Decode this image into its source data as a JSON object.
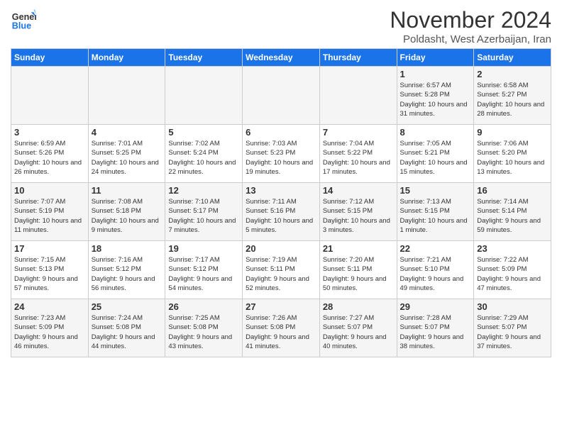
{
  "logo": {
    "line1": "General",
    "line2": "Blue"
  },
  "title": "November 2024",
  "subtitle": "Poldasht, West Azerbaijan, Iran",
  "headers": [
    "Sunday",
    "Monday",
    "Tuesday",
    "Wednesday",
    "Thursday",
    "Friday",
    "Saturday"
  ],
  "weeks": [
    [
      {
        "day": "",
        "info": ""
      },
      {
        "day": "",
        "info": ""
      },
      {
        "day": "",
        "info": ""
      },
      {
        "day": "",
        "info": ""
      },
      {
        "day": "",
        "info": ""
      },
      {
        "day": "1",
        "info": "Sunrise: 6:57 AM\nSunset: 5:28 PM\nDaylight: 10 hours and 31 minutes."
      },
      {
        "day": "2",
        "info": "Sunrise: 6:58 AM\nSunset: 5:27 PM\nDaylight: 10 hours and 28 minutes."
      }
    ],
    [
      {
        "day": "3",
        "info": "Sunrise: 6:59 AM\nSunset: 5:26 PM\nDaylight: 10 hours and 26 minutes."
      },
      {
        "day": "4",
        "info": "Sunrise: 7:01 AM\nSunset: 5:25 PM\nDaylight: 10 hours and 24 minutes."
      },
      {
        "day": "5",
        "info": "Sunrise: 7:02 AM\nSunset: 5:24 PM\nDaylight: 10 hours and 22 minutes."
      },
      {
        "day": "6",
        "info": "Sunrise: 7:03 AM\nSunset: 5:23 PM\nDaylight: 10 hours and 19 minutes."
      },
      {
        "day": "7",
        "info": "Sunrise: 7:04 AM\nSunset: 5:22 PM\nDaylight: 10 hours and 17 minutes."
      },
      {
        "day": "8",
        "info": "Sunrise: 7:05 AM\nSunset: 5:21 PM\nDaylight: 10 hours and 15 minutes."
      },
      {
        "day": "9",
        "info": "Sunrise: 7:06 AM\nSunset: 5:20 PM\nDaylight: 10 hours and 13 minutes."
      }
    ],
    [
      {
        "day": "10",
        "info": "Sunrise: 7:07 AM\nSunset: 5:19 PM\nDaylight: 10 hours and 11 minutes."
      },
      {
        "day": "11",
        "info": "Sunrise: 7:08 AM\nSunset: 5:18 PM\nDaylight: 10 hours and 9 minutes."
      },
      {
        "day": "12",
        "info": "Sunrise: 7:10 AM\nSunset: 5:17 PM\nDaylight: 10 hours and 7 minutes."
      },
      {
        "day": "13",
        "info": "Sunrise: 7:11 AM\nSunset: 5:16 PM\nDaylight: 10 hours and 5 minutes."
      },
      {
        "day": "14",
        "info": "Sunrise: 7:12 AM\nSunset: 5:15 PM\nDaylight: 10 hours and 3 minutes."
      },
      {
        "day": "15",
        "info": "Sunrise: 7:13 AM\nSunset: 5:15 PM\nDaylight: 10 hours and 1 minute."
      },
      {
        "day": "16",
        "info": "Sunrise: 7:14 AM\nSunset: 5:14 PM\nDaylight: 9 hours and 59 minutes."
      }
    ],
    [
      {
        "day": "17",
        "info": "Sunrise: 7:15 AM\nSunset: 5:13 PM\nDaylight: 9 hours and 57 minutes."
      },
      {
        "day": "18",
        "info": "Sunrise: 7:16 AM\nSunset: 5:12 PM\nDaylight: 9 hours and 56 minutes."
      },
      {
        "day": "19",
        "info": "Sunrise: 7:17 AM\nSunset: 5:12 PM\nDaylight: 9 hours and 54 minutes."
      },
      {
        "day": "20",
        "info": "Sunrise: 7:19 AM\nSunset: 5:11 PM\nDaylight: 9 hours and 52 minutes."
      },
      {
        "day": "21",
        "info": "Sunrise: 7:20 AM\nSunset: 5:11 PM\nDaylight: 9 hours and 50 minutes."
      },
      {
        "day": "22",
        "info": "Sunrise: 7:21 AM\nSunset: 5:10 PM\nDaylight: 9 hours and 49 minutes."
      },
      {
        "day": "23",
        "info": "Sunrise: 7:22 AM\nSunset: 5:09 PM\nDaylight: 9 hours and 47 minutes."
      }
    ],
    [
      {
        "day": "24",
        "info": "Sunrise: 7:23 AM\nSunset: 5:09 PM\nDaylight: 9 hours and 46 minutes."
      },
      {
        "day": "25",
        "info": "Sunrise: 7:24 AM\nSunset: 5:08 PM\nDaylight: 9 hours and 44 minutes."
      },
      {
        "day": "26",
        "info": "Sunrise: 7:25 AM\nSunset: 5:08 PM\nDaylight: 9 hours and 43 minutes."
      },
      {
        "day": "27",
        "info": "Sunrise: 7:26 AM\nSunset: 5:08 PM\nDaylight: 9 hours and 41 minutes."
      },
      {
        "day": "28",
        "info": "Sunrise: 7:27 AM\nSunset: 5:07 PM\nDaylight: 9 hours and 40 minutes."
      },
      {
        "day": "29",
        "info": "Sunrise: 7:28 AM\nSunset: 5:07 PM\nDaylight: 9 hours and 38 minutes."
      },
      {
        "day": "30",
        "info": "Sunrise: 7:29 AM\nSunset: 5:07 PM\nDaylight: 9 hours and 37 minutes."
      }
    ]
  ]
}
